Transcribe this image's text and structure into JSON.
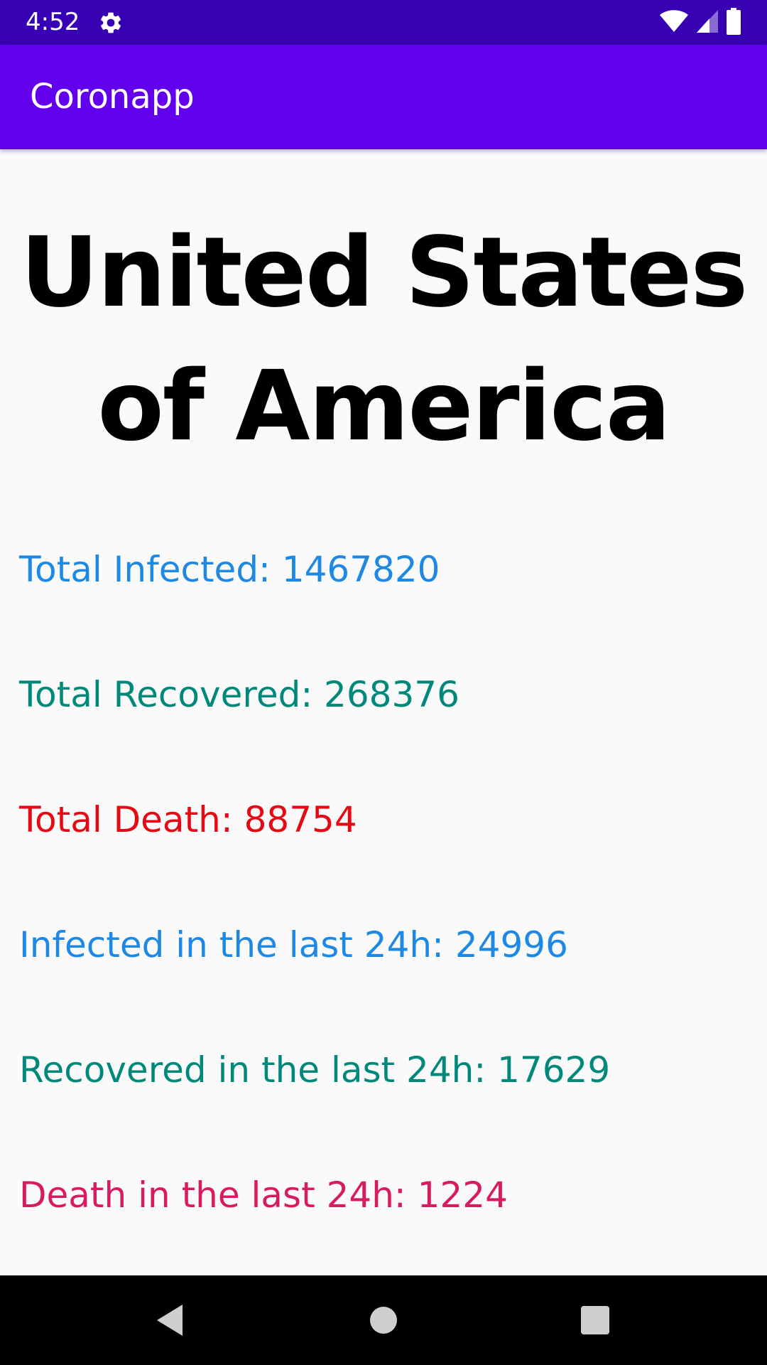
{
  "status_bar": {
    "time": "4:52",
    "icons": [
      "gear-icon",
      "wifi-icon",
      "signal-icon",
      "battery-icon"
    ]
  },
  "app_bar": {
    "title": "Coronapp"
  },
  "country": {
    "line1": "United States",
    "line2": "of America"
  },
  "stats": [
    {
      "text": "Total Infected: 1467820",
      "color": "#1e88e5"
    },
    {
      "text": "Total Recovered: 268376",
      "color": "#00897b"
    },
    {
      "text": "Total Death: 88754",
      "color": "#e50914"
    },
    {
      "text": "Infected in the last 24h: 24996",
      "color": "#1e88e5"
    },
    {
      "text": "Recovered in the last 24h: 17629",
      "color": "#00897b"
    },
    {
      "text": "Death in the last 24h: 1224",
      "color": "#d81b60"
    }
  ],
  "colors": {
    "status_bar": "#3700b3",
    "app_bar": "#6200ee",
    "background": "#fafafa"
  },
  "nav_bar": {
    "icons": [
      "back-icon",
      "home-icon",
      "recents-icon"
    ]
  }
}
